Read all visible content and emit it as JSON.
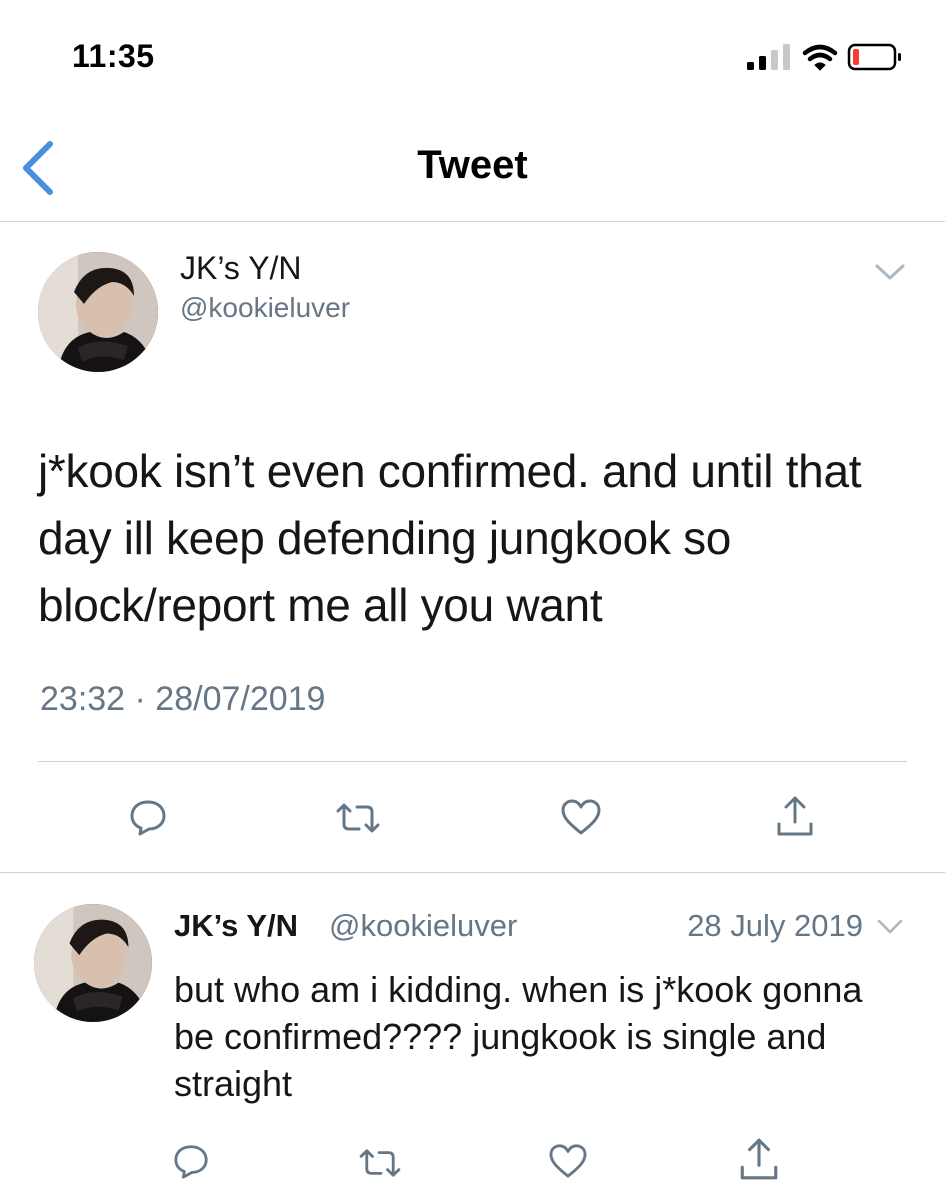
{
  "status_bar": {
    "time": "11:35"
  },
  "nav": {
    "title": "Tweet"
  },
  "main_tweet": {
    "display_name": "JK’s Y/N",
    "handle": "@kookieluver",
    "text": "j*kook isn’t even confirmed. and until that day ill keep defending jungkook so block/report me all you want",
    "timestamp": "23:32 · 28/07/2019"
  },
  "reply_tweet": {
    "display_name": "JK’s Y/N",
    "handle": "@kookieluver",
    "date": "28 July 2019",
    "text": "but who am i kidding. when is j*kook gonna be confirmed???? jungkook is single and straight"
  },
  "colors": {
    "accent": "#4a90e2",
    "text": "#14171a",
    "muted": "#657786",
    "icon": "#657786",
    "divider": "#ccd1d6",
    "battery_low": "#ff3b30"
  },
  "icons": [
    "back-chevron",
    "cellular-signal",
    "wifi",
    "battery",
    "chevron-down",
    "reply",
    "retweet",
    "like",
    "share"
  ]
}
